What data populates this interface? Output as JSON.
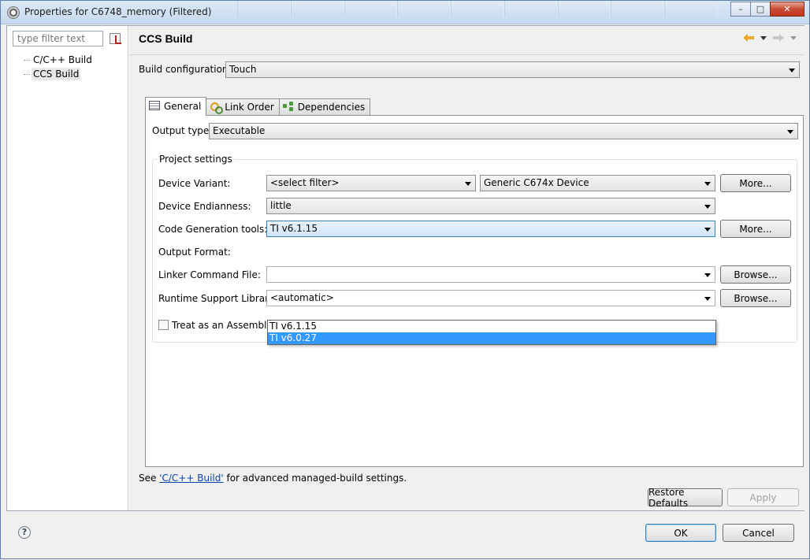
{
  "window": {
    "title": "Properties for C6748_memory (Filtered)",
    "minimize": "–",
    "maximize": "□",
    "close": "✕"
  },
  "sidebar": {
    "filter_placeholder": "type filter text",
    "items": [
      {
        "label": "C/C++ Build"
      },
      {
        "label": "CCS Build"
      }
    ]
  },
  "page": {
    "title": "CCS Build",
    "build_config_label": "Build configuration:",
    "build_config_value": "Touch"
  },
  "tabs": [
    {
      "label": "General"
    },
    {
      "label": "Link Order"
    },
    {
      "label": "Dependencies"
    }
  ],
  "general": {
    "output_type_label": "Output type:",
    "output_type_value": "Executable",
    "group_title": "Project settings",
    "device_variant_label": "Device Variant:",
    "device_filter_value": "<select filter>",
    "device_value": "Generic C674x Device",
    "more_label": "More...",
    "endianness_label": "Device Endianness:",
    "endianness_value": "little",
    "codegen_label": "Code Generation tools:",
    "codegen_value": "TI v6.1.15",
    "codegen_options": [
      "TI v6.1.15",
      "TI v6.0.27"
    ],
    "output_format_label": "Output Format:",
    "linker_cmd_label": "Linker Command File:",
    "linker_cmd_value": "",
    "browse_label": "Browse...",
    "rts_label": "Runtime Support Library:",
    "rts_value": "<automatic>",
    "assembly_only_label": "Treat as an Assembly-only project"
  },
  "footer": {
    "see_prefix": "See ",
    "link_text": "'C/C++ Build'",
    "see_suffix": " for advanced managed-build settings.",
    "restore_defaults": "Restore Defaults",
    "apply": "Apply",
    "ok": "OK",
    "cancel": "Cancel",
    "help": "?"
  }
}
